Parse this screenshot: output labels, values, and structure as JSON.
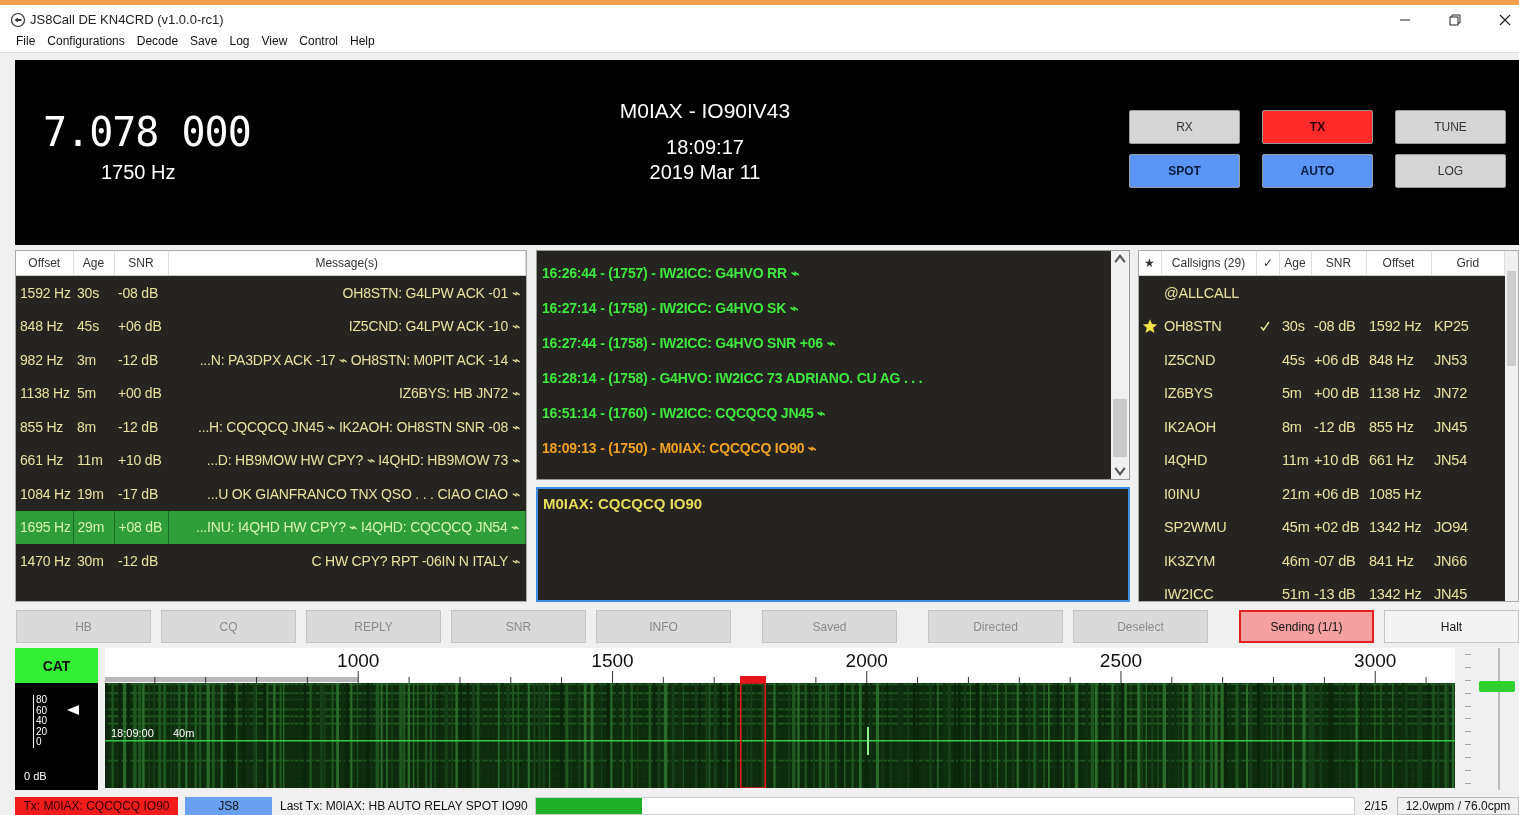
{
  "window": {
    "title": "JS8Call DE KN4CRD (v1.0.0-rc1)"
  },
  "menu": [
    "File",
    "Configurations",
    "Decode",
    "Save",
    "Log",
    "View",
    "Control",
    "Help"
  ],
  "header": {
    "frequency": "7.078 000",
    "offset": "1750 Hz",
    "station": "M0IAX - IO90IV43",
    "time": "18:09:17",
    "date": "2019 Mar 11",
    "buttons": [
      {
        "label": "RX",
        "on": false
      },
      {
        "label": "TX",
        "on": true,
        "kind": "transmit"
      },
      {
        "label": "TUNE",
        "on": false
      },
      {
        "label": "SPOT",
        "on": true,
        "kind": "toggle"
      },
      {
        "label": "AUTO",
        "on": true,
        "kind": "toggle"
      },
      {
        "label": "LOG",
        "on": false
      }
    ]
  },
  "activity": {
    "columns": [
      "Offset",
      "Age",
      "SNR",
      "Message(s)"
    ],
    "rows": [
      {
        "offset": "1592 Hz",
        "age": "30s",
        "snr": "-08 dB",
        "message": "OH8STN: G4LPW ACK -01 ⌁",
        "selected": false
      },
      {
        "offset": "848 Hz",
        "age": "45s",
        "snr": "+06 dB",
        "message": "IZ5CND: G4LPW ACK -10 ⌁",
        "selected": false
      },
      {
        "offset": "982 Hz",
        "age": "3m",
        "snr": "-12 dB",
        "message": "...N: PA3DPX ACK -17 ⌁ OH8STN: M0PIT ACK -14 ⌁",
        "selected": false
      },
      {
        "offset": "1138 Hz",
        "age": "5m",
        "snr": "+00 dB",
        "message": "IZ6BYS: HB JN72 ⌁",
        "selected": false
      },
      {
        "offset": "855 Hz",
        "age": "8m",
        "snr": "-12 dB",
        "message": "...H: CQCQCQ JN45 ⌁ IK2AOH: OH8STN SNR -08 ⌁",
        "selected": false
      },
      {
        "offset": "661 Hz",
        "age": "11m",
        "snr": "+10 dB",
        "message": "...D: HB9MOW HW CPY? ⌁ I4QHD: HB9MOW 73 ⌁",
        "selected": false
      },
      {
        "offset": "1084 Hz",
        "age": "19m",
        "snr": "-17 dB",
        "message": "...U  OK GIANFRANCO TNX QSO  . . . CIAO CIAO ⌁",
        "selected": false
      },
      {
        "offset": "1695 Hz",
        "age": "29m",
        "snr": "+08 dB",
        "message": "...INU: I4QHD HW CPY? ⌁ I4QHD: CQCQCQ JN54 ⌁",
        "selected": true
      },
      {
        "offset": "1470 Hz",
        "age": "30m",
        "snr": "-12 dB",
        "message": "C HW CPY? RPT -06IN N ITALY ⌁",
        "selected": false
      }
    ]
  },
  "log": [
    {
      "text": "16:26:44 - (1757) - IW2ICC: G4HVO RR ⌁",
      "kind": "rx"
    },
    {
      "text": "16:27:14 - (1758) - IW2ICC: G4HVO SK ⌁",
      "kind": "rx"
    },
    {
      "text": "16:27:44 - (1758) - IW2ICC: G4HVO SNR +06 ⌁",
      "kind": "rx"
    },
    {
      "text": "16:28:14 - (1758) - G4HVO: IW2ICC 73 ADRIANO.  CU AG . . .",
      "kind": "rx"
    },
    {
      "text": "16:51:14 - (1760) - IW2ICC: CQCQCQ JN45 ⌁",
      "kind": "rx"
    },
    {
      "text": "18:09:13 - (1750) - M0IAX: CQCQCQ IO90 ⌁",
      "kind": "tx"
    }
  ],
  "compose": {
    "value": "M0IAX: CQCQCQ IO90"
  },
  "callsigns": {
    "columns": [
      "★",
      "Callsigns (29)",
      "✓",
      "Age",
      "SNR",
      "Offset",
      "Grid"
    ],
    "rows": [
      {
        "call": "@ALLCALL",
        "starred": false,
        "checked": false
      },
      {
        "call": "OH8STN",
        "starred": true,
        "checked": true,
        "age": "30s",
        "snr": "-08 dB",
        "offset": "1592 Hz",
        "grid": "KP25"
      },
      {
        "call": "IZ5CND",
        "starred": false,
        "checked": false,
        "age": "45s",
        "snr": "+06 dB",
        "offset": "848 Hz",
        "grid": "JN53"
      },
      {
        "call": "IZ6BYS",
        "starred": false,
        "checked": false,
        "age": "5m",
        "snr": "+00 dB",
        "offset": "1138 Hz",
        "grid": "JN72"
      },
      {
        "call": "IK2AOH",
        "starred": false,
        "checked": false,
        "age": "8m",
        "snr": "-12 dB",
        "offset": "855 Hz",
        "grid": "JN45"
      },
      {
        "call": "I4QHD",
        "starred": false,
        "checked": false,
        "age": "11m",
        "snr": "+10 dB",
        "offset": "661 Hz",
        "grid": "JN54"
      },
      {
        "call": "I0INU",
        "starred": false,
        "checked": false,
        "age": "21m",
        "snr": "+06 dB",
        "offset": "1085 Hz"
      },
      {
        "call": "SP2WMU",
        "starred": false,
        "checked": false,
        "age": "45m",
        "snr": "+02 dB",
        "offset": "1342 Hz",
        "grid": "JO94"
      },
      {
        "call": "IK3ZYM",
        "starred": false,
        "checked": false,
        "age": "46m",
        "snr": "-07 dB",
        "offset": "841 Hz",
        "grid": "JN66"
      },
      {
        "call": "IW2ICC",
        "starred": false,
        "checked": false,
        "age": "51m",
        "snr": "-13 dB",
        "offset": "1342 Hz",
        "grid": "JN45"
      }
    ]
  },
  "macros": [
    {
      "label": "HB",
      "disabled": true,
      "active": false
    },
    {
      "label": "CQ",
      "disabled": true,
      "active": false
    },
    {
      "label": "REPLY",
      "disabled": true,
      "active": false
    },
    {
      "label": "SNR",
      "disabled": true,
      "active": false
    },
    {
      "label": "INFO",
      "disabled": true,
      "active": false
    },
    {
      "label": "Saved",
      "disabled": true,
      "active": false
    },
    {
      "label": "Directed",
      "disabled": true,
      "active": false
    },
    {
      "label": "Deselect",
      "disabled": true,
      "active": false
    },
    {
      "label": "Sending (1/1)",
      "disabled": false,
      "active": true
    },
    {
      "label": "Halt",
      "disabled": false,
      "active": false
    }
  ],
  "waterfall": {
    "cat": "CAT",
    "meter": {
      "labels": [
        "80",
        "60",
        "40",
        "20",
        "0"
      ],
      "reading": "0 dB"
    },
    "scale": [
      "1000",
      "1500",
      "2000",
      "2500",
      "3000"
    ],
    "time": "18:09:00",
    "band": "40m",
    "tx_slider": {
      "level": 0.75
    }
  },
  "status": {
    "tx": "Tx: M0IAX: CQCQCQ IO90",
    "mode": "JS8",
    "last_tx": "Last Tx: M0IAX: HB AUTO RELAY SPOT IO90",
    "progress": {
      "level": 0.13
    },
    "page": "2/15",
    "speed": "12.0wpm / 76.0cpm"
  }
}
